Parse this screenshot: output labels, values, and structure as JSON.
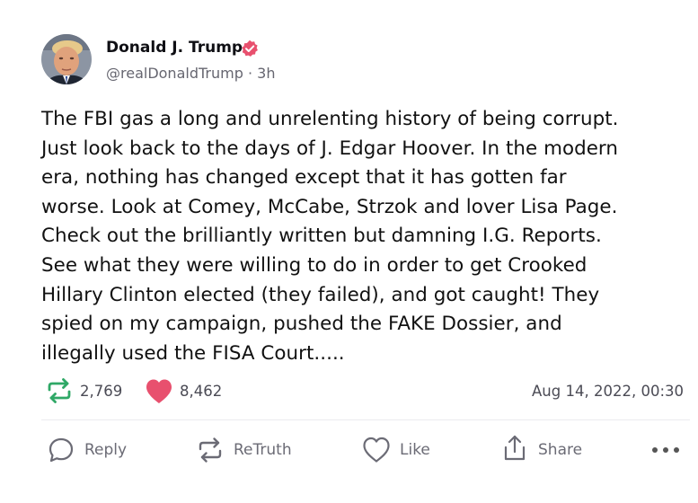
{
  "author": {
    "name": "Donald J. Trump",
    "handle": "@realDonaldTrump",
    "separator": "·",
    "time_ago": "3h"
  },
  "post": {
    "lines": [
      "The FBI gas a long and unrelenting history of being corrupt.",
      "Just look back to the days of J. Edgar Hoover. In the modern",
      "era, nothing has changed except that it has gotten far",
      "worse. Look at Comey, McCabe, Strzok and lover Lisa Page.",
      "Check out the brilliantly written but damning I.G. Reports.",
      "See what they were willing to do in order to get Crooked",
      "Hillary Clinton elected (they failed), and got caught! They",
      "spied on my campaign, pushed the FAKE Dossier, and",
      "illegally used the FISA Court....."
    ]
  },
  "stats": {
    "retruths": "2,769",
    "likes": "8,462",
    "timestamp": "Aug 14, 2022, 00:30"
  },
  "actions": {
    "reply": "Reply",
    "retruth": "ReTruth",
    "like": "Like",
    "share": "Share"
  },
  "colors": {
    "verified_badge": "#e8506e",
    "retruth_green": "#2fa866",
    "like_pink": "#e8506e",
    "divider": "#ececef"
  },
  "icons": {
    "verified": "verified-badge-icon",
    "retruth_stat": "retruth-icon",
    "like_stat": "heart-filled-icon",
    "reply": "comment-icon",
    "retruth_action": "retruth-icon",
    "like_action": "heart-outline-icon",
    "share": "share-upload-icon",
    "more": "more-dots-icon"
  }
}
